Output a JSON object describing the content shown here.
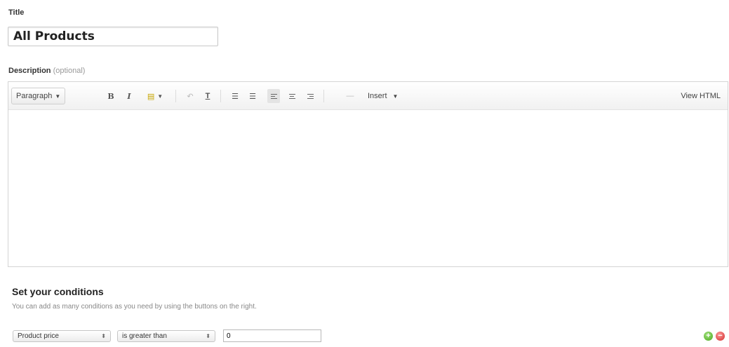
{
  "title_field": {
    "label": "Title",
    "value": "All Products"
  },
  "description_field": {
    "label": "Description",
    "optional_hint": "(optional)",
    "value": ""
  },
  "toolbar": {
    "paragraph_label": "Paragraph",
    "bold_label": "B",
    "italic_label": "I",
    "clear_format_label": "T",
    "insert_label": "Insert",
    "view_html_label": "View HTML",
    "icons": [
      "text-color-icon",
      "undo-icon",
      "clear-formatting-icon",
      "bulleted-list-icon",
      "numbered-list-icon",
      "align-left-icon",
      "align-center-icon",
      "align-right-icon",
      "horizontal-rule-icon"
    ]
  },
  "conditions": {
    "heading": "Set your conditions",
    "help": "You can add as many conditions as you need by using the buttons on the right.",
    "rows": [
      {
        "field": "Product price",
        "operator": "is greater than",
        "value": "0"
      }
    ],
    "add_symbol": "+",
    "remove_symbol": "−",
    "colors": {
      "add": "#4ba81f",
      "remove": "#d02b2b"
    }
  }
}
